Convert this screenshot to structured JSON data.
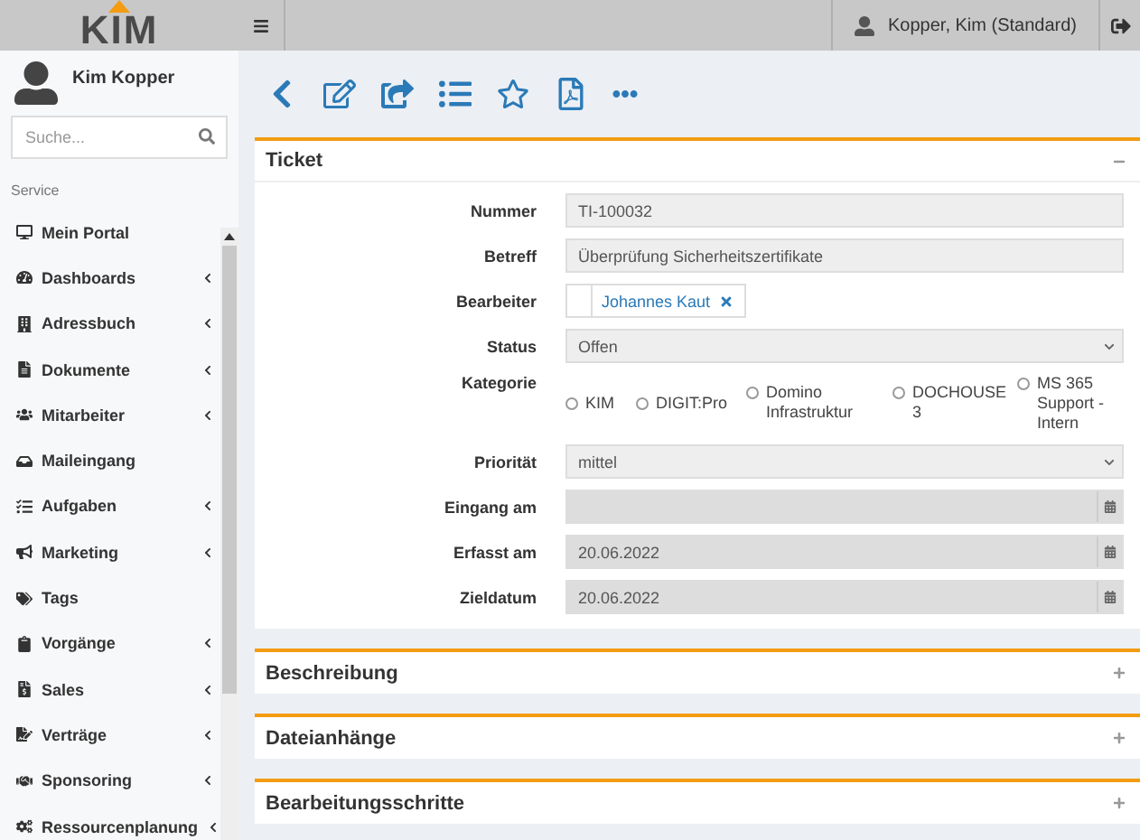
{
  "topbar": {
    "logo": "KIM",
    "user": "Kopper, Kim (Standard)"
  },
  "sidebar": {
    "user_name": "Kim Kopper",
    "search": {
      "placeholder": "Suche..."
    },
    "section": "Service",
    "items": [
      {
        "label": "Mein Portal",
        "has_submenu": false
      },
      {
        "label": "Dashboards",
        "has_submenu": true
      },
      {
        "label": "Adressbuch",
        "has_submenu": true
      },
      {
        "label": "Dokumente",
        "has_submenu": true
      },
      {
        "label": "Mitarbeiter",
        "has_submenu": true
      },
      {
        "label": "Maileingang",
        "has_submenu": false
      },
      {
        "label": "Aufgaben",
        "has_submenu": true
      },
      {
        "label": "Marketing",
        "has_submenu": true
      },
      {
        "label": "Tags",
        "has_submenu": false
      },
      {
        "label": "Vorgänge",
        "has_submenu": true
      },
      {
        "label": "Sales",
        "has_submenu": true
      },
      {
        "label": "Verträge",
        "has_submenu": true
      },
      {
        "label": "Sponsoring",
        "has_submenu": true
      },
      {
        "label": "Ressourcenplanung",
        "has_submenu": true
      }
    ]
  },
  "sections": [
    {
      "title": "Ticket",
      "expanded": true,
      "fields": [
        {
          "kind": "text",
          "label": "Nummer",
          "value": "TI-100032"
        },
        {
          "kind": "text",
          "label": "Betreff",
          "value": "Überprüfung Sicherheitszertifikate"
        },
        {
          "kind": "tag",
          "label": "Bearbeiter",
          "value": "Johannes Kaut"
        },
        {
          "kind": "select",
          "label": "Status",
          "value": "Offen"
        },
        {
          "kind": "radio",
          "label": "Kategorie",
          "options": [
            {
              "label": "KIM",
              "selected": false
            },
            {
              "label": "DIGIT:Pro",
              "selected": false
            },
            {
              "label": "Domino Infrastruktur",
              "selected": false
            },
            {
              "label": "DOCHOUSE 3",
              "selected": false
            },
            {
              "label": "MS 365 Support - Intern",
              "selected": false
            }
          ]
        },
        {
          "kind": "select",
          "label": "Priorität",
          "value": "mittel"
        },
        {
          "kind": "date",
          "label": "Eingang am"
        },
        {
          "kind": "date",
          "label": "Erfasst am",
          "value": "20.06.2022"
        },
        {
          "kind": "date",
          "label": "Zieldatum",
          "value": "20.06.2022"
        }
      ]
    },
    {
      "title": "Beschreibung",
      "expanded": false
    },
    {
      "title": "Dateianhänge",
      "expanded": false
    },
    {
      "title": "Bearbeitungsschritte",
      "expanded": false
    }
  ]
}
